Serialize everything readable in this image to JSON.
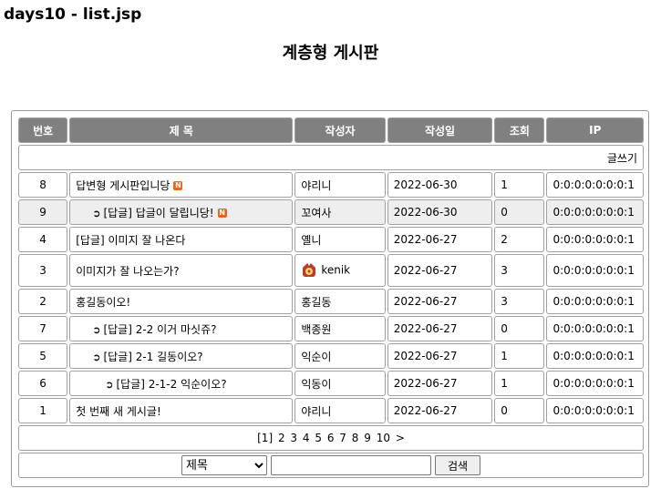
{
  "page_title": "days10 - list.jsp",
  "heading": "계층형 게시판",
  "write_label": "글쓰기",
  "columns": [
    "번호",
    "제 목",
    "작성자",
    "작성일",
    "조회",
    "IP"
  ],
  "rows": [
    {
      "no": "8",
      "title": "답변형 게시판입니당",
      "depth": 0,
      "new": true,
      "author": "야리니",
      "date": "2022-06-30",
      "views": "1",
      "ip": "0:0:0:0:0:0:0:1",
      "highlight": false,
      "avatar": false
    },
    {
      "no": "9",
      "title": "[답글] 답글이 달립니당!",
      "depth": 1,
      "new": true,
      "author": "꼬여사",
      "date": "2022-06-30",
      "views": "0",
      "ip": "0:0:0:0:0:0:0:1",
      "highlight": true,
      "avatar": false
    },
    {
      "no": "4",
      "title": "[답글] 이미지 잘 나온다",
      "depth": 0,
      "new": false,
      "author": "옐니",
      "date": "2022-06-27",
      "views": "2",
      "ip": "0:0:0:0:0:0:0:1",
      "highlight": false,
      "avatar": false
    },
    {
      "no": "3",
      "title": "이미지가 잘 나오는가?",
      "depth": 0,
      "new": false,
      "author": "kenik",
      "date": "2022-06-27",
      "views": "3",
      "ip": "0:0:0:0:0:0:0:1",
      "highlight": false,
      "avatar": true
    },
    {
      "no": "2",
      "title": "홍길동이오!",
      "depth": 0,
      "new": false,
      "author": "홍길동",
      "date": "2022-06-27",
      "views": "3",
      "ip": "0:0:0:0:0:0:0:1",
      "highlight": false,
      "avatar": false
    },
    {
      "no": "7",
      "title": "[답글] 2-2 이거 마싯쥬?",
      "depth": 1,
      "new": false,
      "author": "백종원",
      "date": "2022-06-27",
      "views": "0",
      "ip": "0:0:0:0:0:0:0:1",
      "highlight": false,
      "avatar": false
    },
    {
      "no": "5",
      "title": "[답글] 2-1 길동이오?",
      "depth": 1,
      "new": false,
      "author": "익순이",
      "date": "2022-06-27",
      "views": "1",
      "ip": "0:0:0:0:0:0:0:1",
      "highlight": false,
      "avatar": false
    },
    {
      "no": "6",
      "title": "[답글] 2-1-2 익순이오?",
      "depth": 2,
      "new": false,
      "author": "익동이",
      "date": "2022-06-27",
      "views": "1",
      "ip": "0:0:0:0:0:0:0:1",
      "highlight": false,
      "avatar": false
    },
    {
      "no": "1",
      "title": "첫 번째 새 게시글!",
      "depth": 0,
      "new": false,
      "author": "야리니",
      "date": "2022-06-27",
      "views": "0",
      "ip": "0:0:0:0:0:0:0:1",
      "highlight": false,
      "avatar": false
    }
  ],
  "pagination": {
    "current": "[1]",
    "pages": [
      "2",
      "3",
      "4",
      "5",
      "6",
      "7",
      "8",
      "9",
      "10"
    ],
    "next": ">"
  },
  "search": {
    "field_selected": "제목",
    "query": "",
    "button_label": "검색"
  },
  "new_badge_text": "N",
  "colors": {
    "header_bg": "#808080",
    "highlight_row": "#eeeeee",
    "new_badge": "#e8661c"
  }
}
